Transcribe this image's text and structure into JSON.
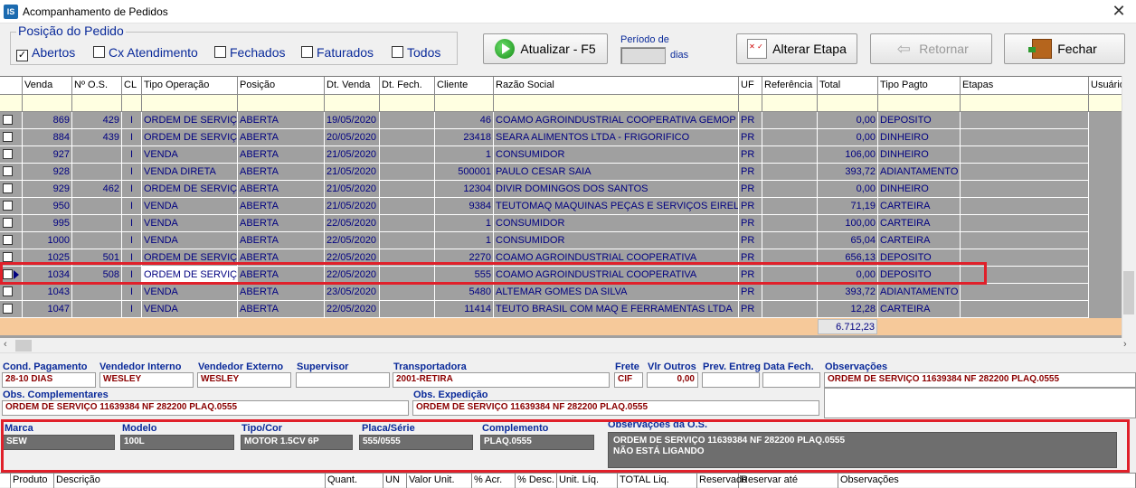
{
  "window": {
    "title": "Acompanhamento de Pedidos",
    "icon": "IS",
    "close": "✕"
  },
  "position_group": {
    "title": "Posição do Pedido",
    "options": [
      {
        "label": "Abertos",
        "checked": true
      },
      {
        "label": "Cx Atendimento",
        "checked": false
      },
      {
        "label": "Fechados",
        "checked": false
      },
      {
        "label": "Faturados",
        "checked": false
      },
      {
        "label": "Todos",
        "checked": false
      }
    ]
  },
  "toolbar": {
    "refresh": "Atualizar - F5",
    "period_label": "Período de",
    "period_value": "",
    "days_label": "dias",
    "alter_stage": "Alterar Etapa",
    "back": "Retornar",
    "close": "Fechar"
  },
  "grid": {
    "columns": [
      "Venda",
      "Nº O.S.",
      "CL",
      "Tipo Operação",
      "Posição",
      "Dt. Venda",
      "Dt. Fech.",
      "Cliente",
      "Razão Social",
      "UF",
      "Referência",
      "Total",
      "Tipo Pagto",
      "Etapas",
      "Usuário"
    ],
    "rows": [
      [
        "869",
        "429",
        "I",
        "ORDEM DE SERVIÇO",
        "ABERTA",
        "19/05/2020",
        "",
        "46",
        "COAMO AGROINDUSTRIAL COOPERATIVA GEMOP",
        "PR",
        "",
        "0,00",
        "DEPOSITO"
      ],
      [
        "884",
        "439",
        "I",
        "ORDEM DE SERVIÇO",
        "ABERTA",
        "20/05/2020",
        "",
        "23418",
        "SEARA ALIMENTOS LTDA - FRIGORIFICO",
        "PR",
        "",
        "0,00",
        "DINHEIRO"
      ],
      [
        "927",
        "",
        "I",
        "VENDA",
        "ABERTA",
        "21/05/2020",
        "",
        "1",
        "CONSUMIDOR",
        "PR",
        "",
        "106,00",
        "DINHEIRO"
      ],
      [
        "928",
        "",
        "I",
        "VENDA DIRETA",
        "ABERTA",
        "21/05/2020",
        "",
        "500001",
        "PAULO CESAR SAIA",
        "PR",
        "",
        "393,72",
        "ADIANTAMENTO C"
      ],
      [
        "929",
        "462",
        "I",
        "ORDEM DE SERVIÇO",
        "ABERTA",
        "21/05/2020",
        "",
        "12304",
        "DIVIR DOMINGOS DOS SANTOS",
        "PR",
        "",
        "0,00",
        "DINHEIRO"
      ],
      [
        "950",
        "",
        "I",
        "VENDA",
        "ABERTA",
        "21/05/2020",
        "",
        "9384",
        "TEUTOMAQ MAQUINAS PEÇAS E SERVIÇOS EIRELI - MI",
        "PR",
        "",
        "71,19",
        "CARTEIRA"
      ],
      [
        "995",
        "",
        "I",
        "VENDA",
        "ABERTA",
        "22/05/2020",
        "",
        "1",
        "CONSUMIDOR",
        "PR",
        "",
        "100,00",
        "CARTEIRA"
      ],
      [
        "1000",
        "",
        "I",
        "VENDA",
        "ABERTA",
        "22/05/2020",
        "",
        "1",
        "CONSUMIDOR",
        "PR",
        "",
        "65,04",
        "CARTEIRA"
      ],
      [
        "1025",
        "501",
        "I",
        "ORDEM DE SERVIÇO",
        "ABERTA",
        "22/05/2020",
        "",
        "2270",
        "COAMO AGROINDUSTRIAL COOPERATIVA",
        "PR",
        "",
        "656,13",
        "DEPOSITO"
      ],
      [
        "1034",
        "508",
        "I",
        "ORDEM DE SERVIÇO",
        "ABERTA",
        "22/05/2020",
        "",
        "555",
        "COAMO AGROINDUSTRIAL COOPERATIVA",
        "PR",
        "",
        "0,00",
        "DEPOSITO"
      ],
      [
        "1043",
        "",
        "I",
        "VENDA",
        "ABERTA",
        "23/05/2020",
        "",
        "5480",
        "ALTEMAR GOMES DA SILVA",
        "PR",
        "",
        "393,72",
        "ADIANTAMENTO C"
      ],
      [
        "1047",
        "",
        "I",
        "VENDA",
        "ABERTA",
        "22/05/2020",
        "",
        "11414",
        "TEUTO BRASIL COM MAQ E FERRAMENTAS LTDA",
        "PR",
        "",
        "12,28",
        "CARTEIRA"
      ]
    ],
    "selected_row": 9,
    "total": "6.712,23"
  },
  "details": {
    "cond_pagamento": {
      "label": "Cond. Pagamento",
      "value": "28-10 DIAS"
    },
    "vendedor_interno": {
      "label": "Vendedor Interno",
      "value": "WESLEY"
    },
    "vendedor_externo": {
      "label": "Vendedor Externo",
      "value": "WESLEY"
    },
    "supervisor": {
      "label": "Supervisor",
      "value": ""
    },
    "transportadora": {
      "label": "Transportadora",
      "value": "2001-RETIRA"
    },
    "frete": {
      "label": "Frete",
      "value": "CIF"
    },
    "vlr_outros": {
      "label": "Vlr Outros",
      "value": "0,00"
    },
    "prev_entrega": {
      "label": "Prev. Entreg",
      "value": ""
    },
    "data_fech": {
      "label": "Data Fech.",
      "value": ""
    },
    "observacoes": {
      "label": "Observações",
      "value": "ORDEM DE SERVIÇO 11639384 NF 282200 PLAQ.0555"
    },
    "obs_complementares": {
      "label": "Obs. Complementares",
      "value": "ORDEM DE SERVIÇO 11639384 NF 282200 PLAQ.0555"
    },
    "obs_expedicao": {
      "label": "Obs. Expedição",
      "value": "ORDEM DE SERVIÇO 11639384 NF 282200 PLAQ.0555"
    },
    "marca": {
      "label": "Marca",
      "value": "SEW"
    },
    "modelo": {
      "label": "Modelo",
      "value": "100L"
    },
    "tipo_cor": {
      "label": "Tipo/Cor",
      "value": "MOTOR 1.5CV 6P"
    },
    "placa_serie": {
      "label": "Placa/Série",
      "value": "555/0555"
    },
    "complemento": {
      "label": "Complemento",
      "value": "PLAQ.0555"
    },
    "obs_os": {
      "label": "Observações da O.S.",
      "line1": "ORDEM DE SERVIÇO 11639384 NF 282200 PLAQ.0555",
      "line2": "NÃO ESTÁ LIGANDO"
    }
  },
  "items_header": [
    "Produto",
    "Descrição",
    "Quant.",
    "UN",
    "Valor Unit.",
    "% Acr.",
    "% Desc.",
    "Unit. Líq.",
    "TOTAL Liq.",
    "Reservado",
    "Reservar até",
    "Observações"
  ]
}
